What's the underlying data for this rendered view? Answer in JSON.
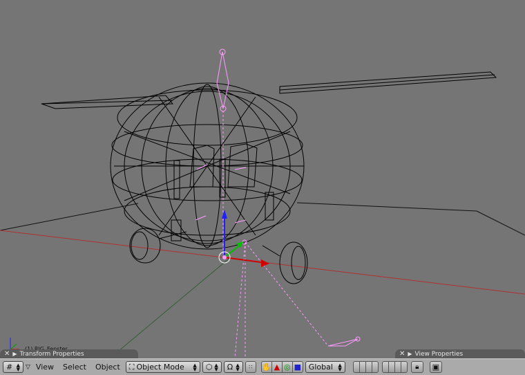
{
  "viewport": {
    "status_label": "(1) RIG_Fenster",
    "colors": {
      "background": "#757575",
      "wire": "#000000",
      "bone": "#ff9cff",
      "x_axis": "#d00000",
      "y_axis": "#00a000",
      "z_axis": "#2020ff"
    }
  },
  "panels": {
    "transform": {
      "title": "Transform Properties",
      "close_icon": "close-icon",
      "expand_icon": "triangle-right-icon"
    },
    "view": {
      "title": "View Properties",
      "close_icon": "close-icon",
      "expand_icon": "triangle-right-icon"
    }
  },
  "header": {
    "editor_type_icon": "grid-icon",
    "menus": {
      "view": "View",
      "select": "Select",
      "object": "Object"
    },
    "mode": {
      "label": "Object Mode",
      "icon": "object-mode-icon"
    },
    "draw_type_icon": "draw-type-icon",
    "pivot_icon": "pivot-icon",
    "widget_icons": {
      "hand": "hand-icon",
      "translate": "translate-icon",
      "rotate": "rotate-icon",
      "scale": "scale-icon"
    },
    "orientation": {
      "label": "Global"
    },
    "lock_icon": "lock-icon",
    "render_icon": "render-icon"
  }
}
